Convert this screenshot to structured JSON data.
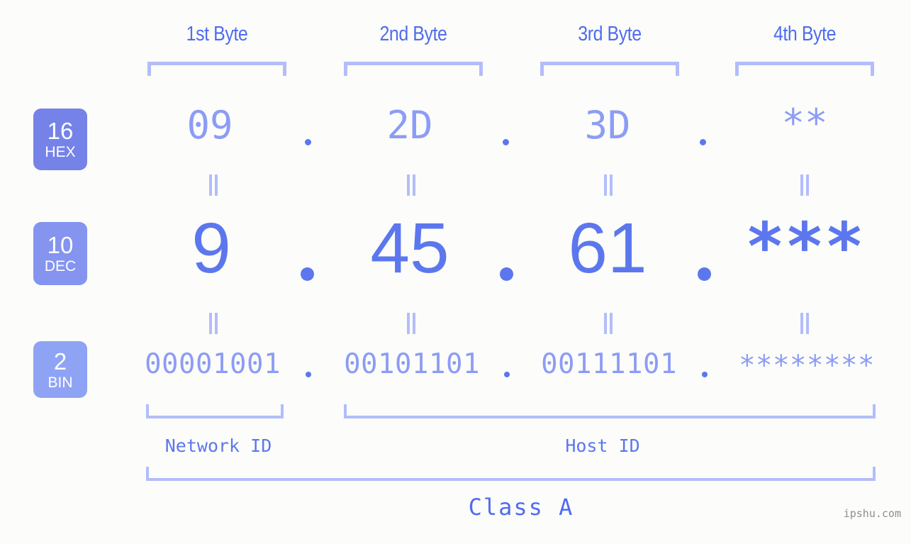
{
  "background_color": "#fcfdfa",
  "accent_color": "#5c77ee",
  "accent_light_color": "#8c9cf6",
  "bracket_color": "#b3bdfb",
  "byte_headers": [
    {
      "label": "1st Byte"
    },
    {
      "label": "2nd Byte"
    },
    {
      "label": "3rd Byte"
    },
    {
      "label": "4th Byte"
    }
  ],
  "bases": [
    {
      "number": "16",
      "name": "HEX",
      "color": "#7582e8"
    },
    {
      "number": "10",
      "name": "DEC",
      "color": "#8494ef"
    },
    {
      "number": "2",
      "name": "BIN",
      "color": "#8fa3f5"
    }
  ],
  "rows": {
    "hex": {
      "values": [
        "09",
        "2D",
        "3D",
        "**"
      ],
      "separator": "."
    },
    "dec": {
      "values": [
        "9",
        "45",
        "61",
        "***"
      ],
      "separator": "."
    },
    "bin": {
      "values": [
        "00001001",
        "00101101",
        "00111101",
        "********"
      ],
      "separator": "."
    }
  },
  "equals_symbol": "=",
  "segments": {
    "network_id": "Network ID",
    "host_id": "Host ID"
  },
  "class_label": "Class A",
  "watermark": "ipshu.com"
}
